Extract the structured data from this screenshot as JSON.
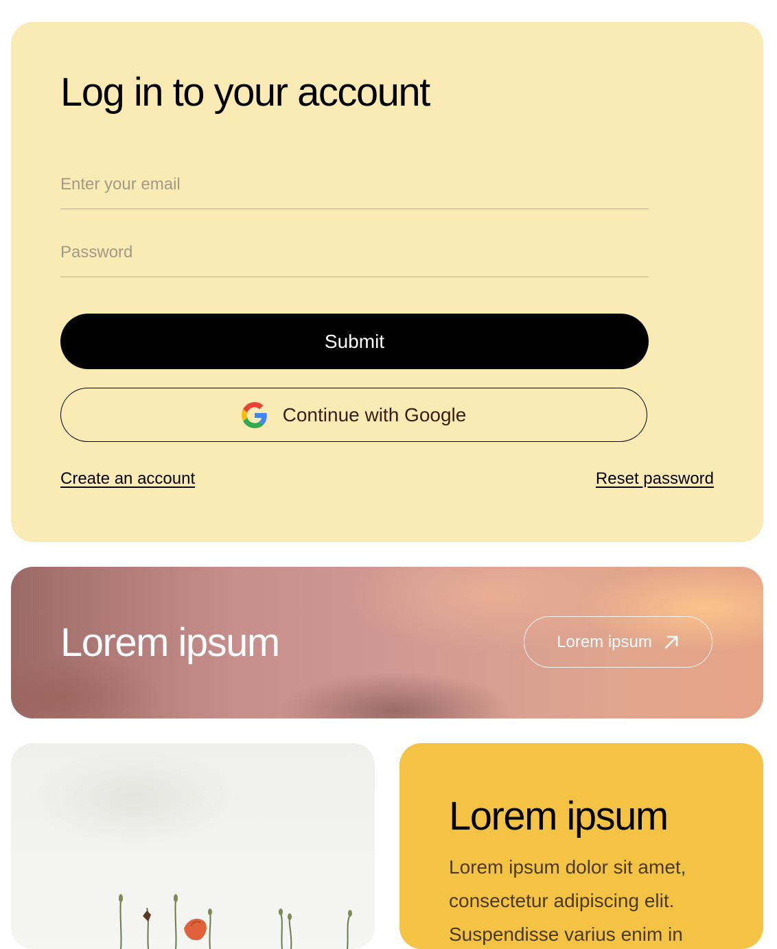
{
  "login": {
    "title": "Log in to your account",
    "email_placeholder": "Enter your email",
    "password_placeholder": "Password",
    "submit_label": "Submit",
    "google_label": "Continue with Google",
    "create_account_label": "Create an account",
    "reset_password_label": "Reset password"
  },
  "banner": {
    "title": "Lorem ipsum",
    "button_label": "Lorem ipsum",
    "button_icon": "arrow-up-right-icon"
  },
  "feature": {
    "title": "Lorem ipsum",
    "text": "Lorem ipsum dolor sit amet, consectetur adipiscing elit. Suspendisse varius enim in"
  },
  "colors": {
    "login_bg": "#faebb5",
    "submit_bg": "#000000",
    "feature_bg": "#f4c343"
  }
}
